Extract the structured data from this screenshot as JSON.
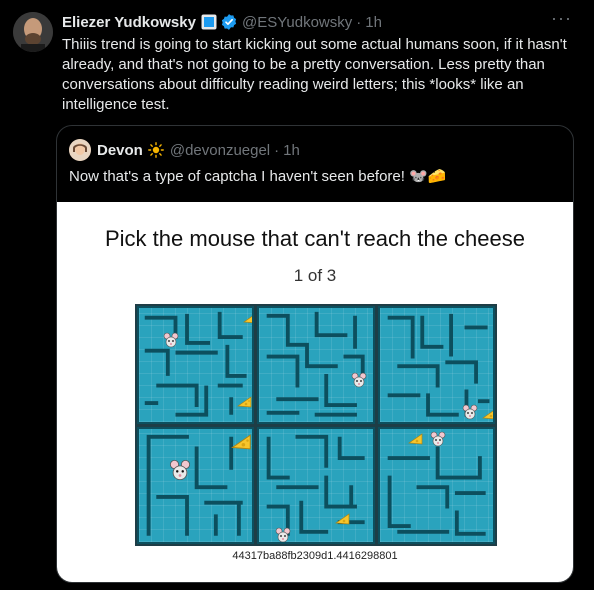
{
  "tweet": {
    "name": "Eliezer Yudkowsky",
    "handle": "@ESYudkowsky",
    "time": "1h",
    "text": "Thiiis trend is going to start kicking out some actual humans soon, if it hasn't already, and that's not going to be a pretty conversation.  Less pretty than conversations about difficulty reading weird letters; this *looks* like an intelligence test.",
    "more_icon": "more-horizontal-icon"
  },
  "quote": {
    "name": "Devon",
    "handle": "@devonzuegel",
    "time": "1h",
    "text": "Now that's a type of captcha I haven't seen before! 🐭🧀"
  },
  "captcha": {
    "title": "Pick the mouse that can't reach the cheese",
    "page": "1 of 3",
    "id": "44317ba88fb2309d1.4416298801",
    "cells": [
      {
        "label": "maze-1"
      },
      {
        "label": "maze-2"
      },
      {
        "label": "maze-3"
      },
      {
        "label": "maze-4"
      },
      {
        "label": "maze-5"
      },
      {
        "label": "maze-6"
      }
    ]
  },
  "colors": {
    "background": "#000000",
    "text": "#e7e9ea",
    "muted": "#71767b",
    "verified": "#1d9bf0",
    "maze_fill": "#2aa3bd",
    "maze_wall": "#0c4f5e"
  }
}
